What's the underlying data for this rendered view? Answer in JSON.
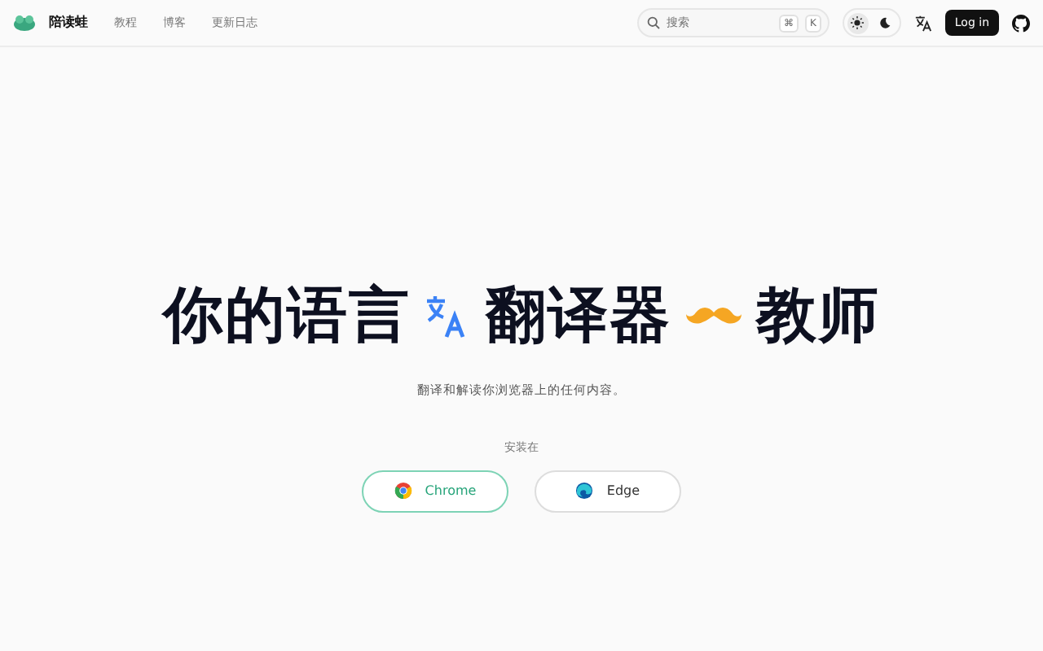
{
  "brand": {
    "name": "陪读蛙"
  },
  "nav_links": [
    {
      "label": "教程"
    },
    {
      "label": "博客"
    },
    {
      "label": "更新日志"
    }
  ],
  "search": {
    "placeholder": "搜索",
    "keys": [
      "⌘",
      "K"
    ]
  },
  "theme_toggle": [
    {
      "kind": "light",
      "selected": true
    },
    {
      "kind": "dark",
      "selected": false
    }
  ],
  "login_button": "Log in",
  "headline": [
    {
      "kind": "text",
      "text": "你的语言"
    },
    {
      "kind": "translate-icon"
    },
    {
      "kind": "text",
      "text": "翻译器"
    },
    {
      "kind": "mustache-icon"
    },
    {
      "kind": "text",
      "text": "教师"
    }
  ],
  "subtitle": "翻译和解读你浏览器上的任何内容。",
  "install_label": "安装在",
  "install_buttons": [
    {
      "kind": "chrome",
      "label": "Chrome",
      "selected": true
    },
    {
      "kind": "edge",
      "label": "Edge",
      "selected": false
    }
  ]
}
